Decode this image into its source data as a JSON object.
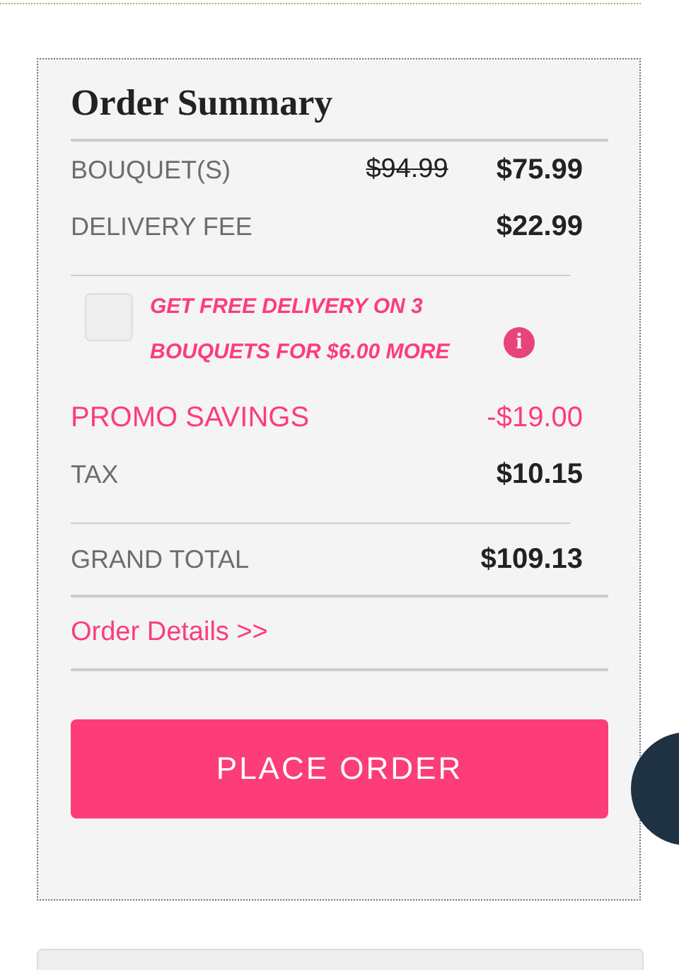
{
  "title": "Order Summary",
  "lines": [
    {
      "label": "BOUQUET(S)",
      "original_price": "$94.99",
      "value": "$75.99"
    },
    {
      "label": "DELIVERY FEE",
      "value": "$22.99"
    }
  ],
  "promo_offer": {
    "text": "GET FREE DELIVERY ON 3 BOUQUETS FOR $6.00 MORE",
    "checked": false,
    "info_icon": "i"
  },
  "totals": [
    {
      "label": "PROMO SAVINGS",
      "value": "-$19.00",
      "kind": "discount"
    },
    {
      "label": "TAX",
      "value": "$10.15",
      "kind": "normal"
    },
    {
      "label": "GRAND TOTAL",
      "value": "$109.13",
      "kind": "total"
    }
  ],
  "details_link": "Order Details >>",
  "button": "PLACE ORDER"
}
